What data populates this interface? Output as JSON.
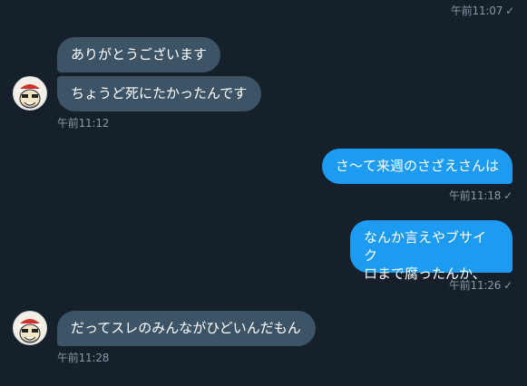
{
  "conversation": {
    "items": [
      {
        "type": "timestamp",
        "side": "out",
        "text": "午前11:07",
        "check": "✓"
      },
      {
        "type": "message",
        "side": "in",
        "text": "ありがとうございます"
      },
      {
        "type": "message",
        "side": "in",
        "text": "ちょうど死にたかったんです"
      },
      {
        "type": "timestamp",
        "side": "in",
        "text": "午前11:12"
      },
      {
        "type": "message",
        "side": "out",
        "text": "さ〜て来週のさざえさんは"
      },
      {
        "type": "timestamp",
        "side": "out",
        "text": "午前11:18",
        "check": "✓"
      },
      {
        "type": "message",
        "side": "out",
        "lines": [
          "なんか言えやブサイク",
          "ロまで腐ったんか、"
        ]
      },
      {
        "type": "timestamp",
        "side": "out",
        "text": "午前11:26",
        "check": "✓"
      },
      {
        "type": "message",
        "side": "in",
        "text": "だってスレのみんながひどいんだもん"
      },
      {
        "type": "timestamp",
        "side": "in",
        "text": "午前11:28"
      }
    ]
  },
  "colors": {
    "background": "#15202b",
    "incoming_bubble": "#3d5466",
    "outgoing_bubble": "#1d9bf0",
    "timestamp": "#8899a6"
  },
  "avatar_icon": "cartoon-face-avatar-icon"
}
